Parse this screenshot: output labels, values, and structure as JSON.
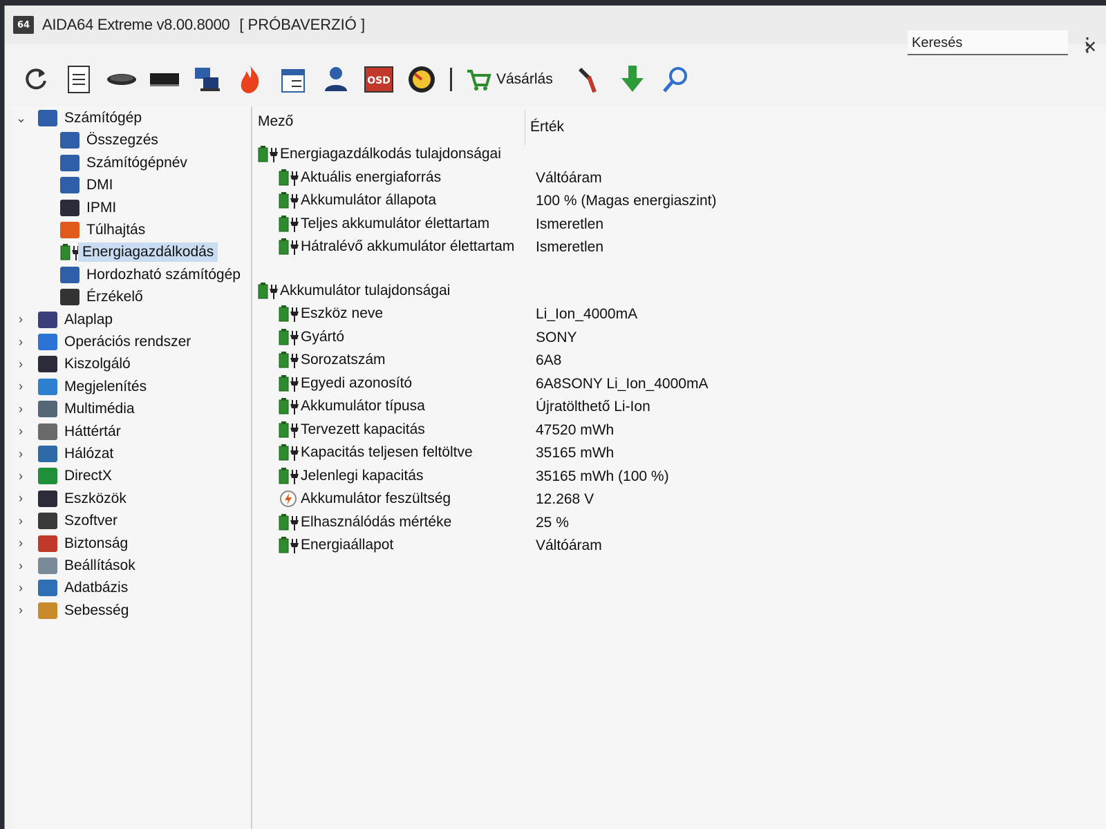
{
  "window": {
    "app_icon_text": "64",
    "title": "AIDA64 Extreme v8.00.8000",
    "title_suffix": "[ PRÓBAVERZIÓ ]",
    "controls": {
      "minimize": "—",
      "maximize": "☐",
      "close": "✕"
    }
  },
  "toolbar": {
    "icons": [
      "refresh-icon",
      "report-icon",
      "disk-icon",
      "memory-icon",
      "network-icon",
      "flame-icon",
      "task-list-icon",
      "user-icon",
      "osd-icon",
      "sensor-icon"
    ],
    "osd_label": "OSD",
    "buy_label": "Vásárlás",
    "extra_icons": [
      "tools-icon",
      "download-icon",
      "search-icon"
    ],
    "search_placeholder": "Keresés",
    "more_label": "⋮"
  },
  "sidebar": {
    "root": {
      "label": "Számítógép",
      "expanded": true
    },
    "children": [
      {
        "label": "Összegzés",
        "icon": "monitor-icon",
        "color": "#2f5fa8"
      },
      {
        "label": "Számítógépnév",
        "icon": "monitor-icon",
        "color": "#2f5fa8"
      },
      {
        "label": "DMI",
        "icon": "monitor-icon",
        "color": "#2f5fa8"
      },
      {
        "label": "IPMI",
        "icon": "server-icon",
        "color": "#2b2b3a"
      },
      {
        "label": "Túlhajtás",
        "icon": "flame-icon",
        "color": "#e05a1b"
      },
      {
        "label": "Energiagazdálkodás",
        "icon": "battery-plug-icon",
        "color": "#2e8b2e",
        "selected": true
      },
      {
        "label": "Hordozható számítógép",
        "icon": "laptop-icon",
        "color": "#2f5fa8"
      },
      {
        "label": "Érzékelő",
        "icon": "gauge-icon",
        "color": "#333333"
      }
    ],
    "groups": [
      {
        "label": "Alaplap",
        "icon": "motherboard-icon",
        "color": "#3a3f7a"
      },
      {
        "label": "Operációs rendszer",
        "icon": "windows-icon",
        "color": "#2b74d6"
      },
      {
        "label": "Kiszolgáló",
        "icon": "server-icon",
        "color": "#2b2b3a"
      },
      {
        "label": "Megjelenítés",
        "icon": "display-icon",
        "color": "#2f7fd0"
      },
      {
        "label": "Multimédia",
        "icon": "speaker-icon",
        "color": "#556677"
      },
      {
        "label": "Háttértár",
        "icon": "storage-icon",
        "color": "#6a6a6a"
      },
      {
        "label": "Hálózat",
        "icon": "network-icon",
        "color": "#2e6aa8"
      },
      {
        "label": "DirectX",
        "icon": "xbox-icon",
        "color": "#1f8f3a"
      },
      {
        "label": "Eszközök",
        "icon": "device-icon",
        "color": "#2b2b3a"
      },
      {
        "label": "Szoftver",
        "icon": "software-icon",
        "color": "#3a3a3a"
      },
      {
        "label": "Biztonság",
        "icon": "shield-icon",
        "color": "#c0392b"
      },
      {
        "label": "Beállítások",
        "icon": "settings-icon",
        "color": "#7a8a99"
      },
      {
        "label": "Adatbázis",
        "icon": "database-icon",
        "color": "#2f6fb5"
      },
      {
        "label": "Sebesség",
        "icon": "speed-icon",
        "color": "#c98a2b"
      }
    ]
  },
  "content": {
    "columns": {
      "field": "Mező",
      "value": "Érték"
    },
    "sections": [
      {
        "title": "Energiagazdálkodás tulajdonságai",
        "rows": [
          {
            "field": "Aktuális energiaforrás",
            "value": "Váltóáram"
          },
          {
            "field": "Akkumulátor állapota",
            "value": "100 % (Magas energiaszint)"
          },
          {
            "field": "Teljes akkumulátor élettartam",
            "value": "Ismeretlen"
          },
          {
            "field": "Hátralévő akkumulátor élettartam",
            "value": "Ismeretlen"
          }
        ]
      },
      {
        "title": "Akkumulátor tulajdonságai",
        "rows": [
          {
            "field": "Eszköz neve",
            "value": "Li_Ion_4000mA"
          },
          {
            "field": "Gyártó",
            "value": "SONY"
          },
          {
            "field": "Sorozatszám",
            "value": "6A8"
          },
          {
            "field": "Egyedi azonosító",
            "value": "6A8SONY Li_Ion_4000mA"
          },
          {
            "field": "Akkumulátor típusa",
            "value": "Újratölthető Li-Ion"
          },
          {
            "field": "Tervezett kapacitás",
            "value": "47520 mWh"
          },
          {
            "field": "Kapacitás teljesen feltöltve",
            "value": "35165 mWh"
          },
          {
            "field": "Jelenlegi kapacitás",
            "value": "35165 mWh  (100 %)"
          },
          {
            "field": "Akkumulátor feszültség",
            "value": "12.268 V",
            "icon": "voltage-icon"
          },
          {
            "field": "Elhasználódás mértéke",
            "value": "25 %"
          },
          {
            "field": "Energiaállapot",
            "value": "Váltóáram"
          }
        ]
      }
    ]
  }
}
